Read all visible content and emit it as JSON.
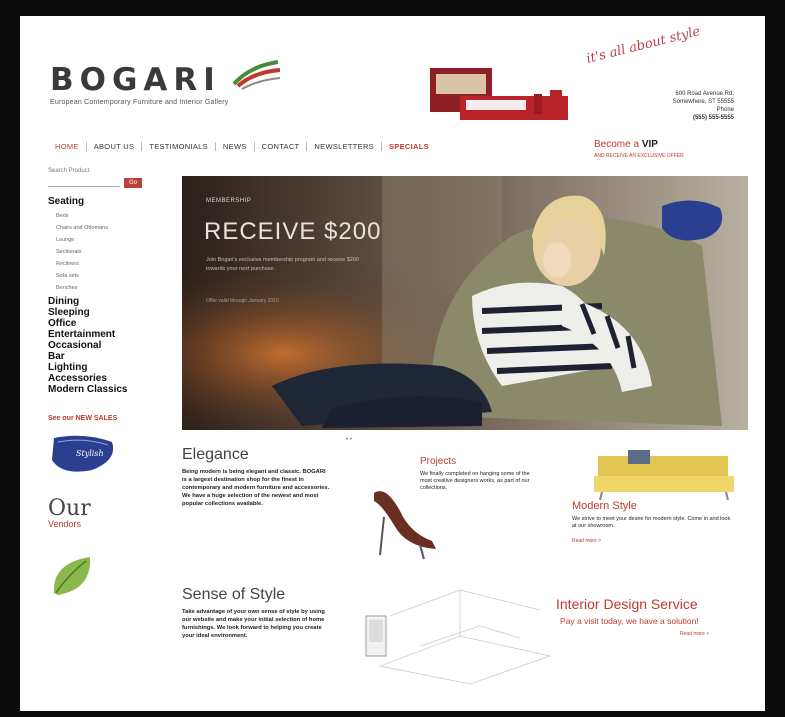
{
  "brand": {
    "name": "BOGARI",
    "tagline": "European Contemporary Furniture and Interior Gallery",
    "script_line": "it's all about style",
    "address": [
      "600 Road Avenue Rd.",
      "Somewhere, ST 55555",
      "Phone",
      "(555) 555-5555"
    ]
  },
  "nav": {
    "items": [
      "HOME",
      "ABOUT US",
      "TESTIMONIALS",
      "NEWS",
      "CONTACT",
      "NEWSLETTERS",
      "SPECIALS"
    ],
    "vip_label": "Become a",
    "vip_strong": "VIP",
    "vip_sub": "AND RECEIVE AN EXCLUSIVE OFFER"
  },
  "sidebar": {
    "search_label": "Search Product",
    "search_placeholder": "",
    "search_button": "Go",
    "categories_top": "Seating",
    "seating_items": [
      "Beds",
      "Chairs and Ottomans",
      "Lounge",
      "Sectionals",
      "Recliners",
      "Sofa sets",
      "Benches"
    ],
    "categories": [
      "Dining",
      "Sleeping",
      "Office",
      "Entertainment",
      "Occasional",
      "Bar",
      "Lighting",
      "Accessories",
      "Modern Classics"
    ],
    "new_label": "See our NEW SALES",
    "badge_text": "Stylish",
    "our_title": "Our",
    "our_sub": "Vendors"
  },
  "hero": {
    "kicker": "MEMBERSHIP",
    "headline": "RECEIVE $200",
    "lines": "Join Bogari's exclusive membership program and receive $200 towards your next purchase.",
    "fine": "Offer valid through January 2010"
  },
  "elegance": {
    "title": "Elegance",
    "body": "Being modern is being elegant and classic. BOGARI is a largest destination shop for the finest in contemporary and modern furniture and accessories. We have a huge selection of the newest and most popular collections available."
  },
  "style": {
    "title": "Sense of Style",
    "body": "Take advantage of your own sense of style by using our website and make your initial selection of home furnishings. We look forward to helping you create your ideal environment."
  },
  "projects": {
    "title": "Projects",
    "body": "We finally completed on hanging some of the most creative designers works, as part of our collections."
  },
  "modern": {
    "title": "Modern Style",
    "body": "We strive to meet your desire for modern style. Come in and look at our showroom.",
    "more": "Read more >"
  },
  "interior": {
    "title": "Interior Design Service",
    "subtitle": "Pay a visit today, we have a solution!",
    "more": "Read more >"
  },
  "colors": {
    "accent": "#c0392b",
    "text": "#222222"
  }
}
